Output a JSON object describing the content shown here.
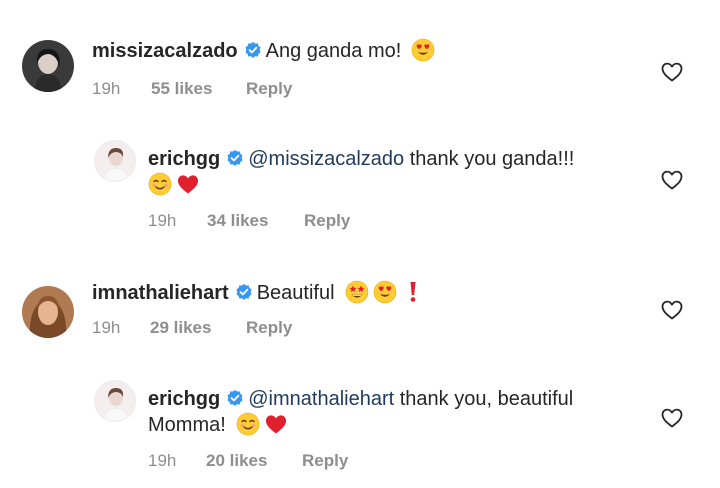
{
  "comments": [
    {
      "username": "missizacalzado",
      "mention": "",
      "text": "Ang ganda mo!",
      "time": "19h",
      "likes": "55 likes",
      "reply": "Reply"
    },
    {
      "username": "erichgg",
      "mention": "@missizacalzado",
      "text": "thank you ganda!!!",
      "time": "19h",
      "likes": "34 likes",
      "reply": "Reply"
    },
    {
      "username": "imnathaliehart",
      "mention": "",
      "text": "Beautiful",
      "time": "19h",
      "likes": "29 likes",
      "reply": "Reply"
    },
    {
      "username": "erichgg",
      "mention": "@imnathaliehart",
      "text": "thank you, beautiful",
      "text_line2": "Momma!",
      "time": "19h",
      "likes": "20 likes",
      "reply": "Reply"
    }
  ],
  "icons": {
    "verified": "verified-badge-icon",
    "like": "heart-outline-icon",
    "heart_eyes": "heart-eyes-emoji",
    "smiling": "smiling-face-emoji",
    "red_heart": "red-heart-emoji",
    "star_struck": "star-struck-emoji",
    "exclamation": "heavy-exclamation-emoji"
  },
  "colors": {
    "verified_blue": "#3897f0",
    "meta_gray": "#8e8e8e",
    "mention": "#1e3a5f",
    "heart_red": "#e0202c"
  }
}
